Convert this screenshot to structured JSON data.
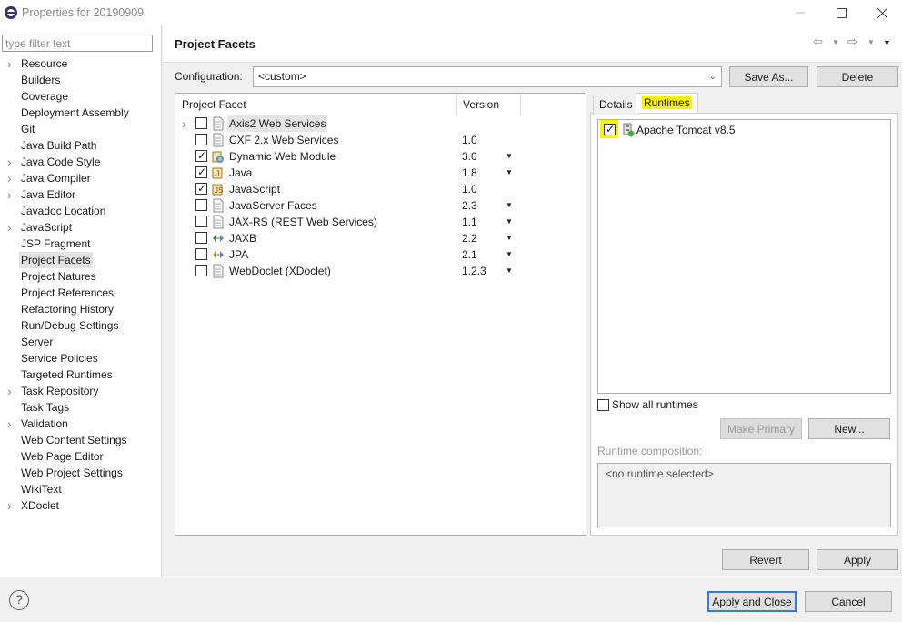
{
  "window": {
    "title": "Properties for 20190909",
    "controls": [
      "minimize-icon",
      "maximize-icon",
      "close-icon"
    ]
  },
  "filter": {
    "placeholder": "type filter text",
    "value": ""
  },
  "tree": {
    "items": [
      {
        "label": "Resource",
        "expandable": true
      },
      {
        "label": "Builders",
        "expandable": false
      },
      {
        "label": "Coverage",
        "expandable": false
      },
      {
        "label": "Deployment Assembly",
        "expandable": false
      },
      {
        "label": "Git",
        "expandable": false
      },
      {
        "label": "Java Build Path",
        "expandable": false
      },
      {
        "label": "Java Code Style",
        "expandable": true
      },
      {
        "label": "Java Compiler",
        "expandable": true
      },
      {
        "label": "Java Editor",
        "expandable": true
      },
      {
        "label": "Javadoc Location",
        "expandable": false
      },
      {
        "label": "JavaScript",
        "expandable": true
      },
      {
        "label": "JSP Fragment",
        "expandable": false
      },
      {
        "label": "Project Facets",
        "expandable": false,
        "selected": true
      },
      {
        "label": "Project Natures",
        "expandable": false
      },
      {
        "label": "Project References",
        "expandable": false
      },
      {
        "label": "Refactoring History",
        "expandable": false
      },
      {
        "label": "Run/Debug Settings",
        "expandable": false
      },
      {
        "label": "Server",
        "expandable": false
      },
      {
        "label": "Service Policies",
        "expandable": false
      },
      {
        "label": "Targeted Runtimes",
        "expandable": false
      },
      {
        "label": "Task Repository",
        "expandable": true
      },
      {
        "label": "Task Tags",
        "expandable": false
      },
      {
        "label": "Validation",
        "expandable": true
      },
      {
        "label": "Web Content Settings",
        "expandable": false
      },
      {
        "label": "Web Page Editor",
        "expandable": false
      },
      {
        "label": "Web Project Settings",
        "expandable": false
      },
      {
        "label": "WikiText",
        "expandable": false
      },
      {
        "label": "XDoclet",
        "expandable": true
      }
    ]
  },
  "header": {
    "title": "Project Facets"
  },
  "configuration": {
    "label": "Configuration:",
    "value": "<custom>",
    "save_as": "Save As...",
    "delete": "Delete"
  },
  "facets": {
    "col_facet": "Project Facet",
    "col_version": "Version",
    "rows": [
      {
        "name": "Axis2 Web Services",
        "version": "",
        "checked": false,
        "dropdown": false,
        "expandable": true,
        "icon": "document-icon"
      },
      {
        "name": "CXF 2.x Web Services",
        "version": "1.0",
        "checked": false,
        "dropdown": false,
        "icon": "document-icon"
      },
      {
        "name": "Dynamic Web Module",
        "version": "3.0",
        "checked": true,
        "dropdown": true,
        "icon": "web-module-icon"
      },
      {
        "name": "Java",
        "version": "1.8",
        "checked": true,
        "dropdown": true,
        "icon": "java-icon"
      },
      {
        "name": "JavaScript",
        "version": "1.0",
        "checked": true,
        "dropdown": false,
        "icon": "javascript-icon"
      },
      {
        "name": "JavaServer Faces",
        "version": "2.3",
        "checked": false,
        "dropdown": true,
        "icon": "document-icon"
      },
      {
        "name": "JAX-RS (REST Web Services)",
        "version": "1.1",
        "checked": false,
        "dropdown": true,
        "icon": "document-icon"
      },
      {
        "name": "JAXB",
        "version": "2.2",
        "checked": false,
        "dropdown": true,
        "icon": "jaxb-icon"
      },
      {
        "name": "JPA",
        "version": "2.1",
        "checked": false,
        "dropdown": true,
        "icon": "jpa-icon"
      },
      {
        "name": "WebDoclet (XDoclet)",
        "version": "1.2.3",
        "checked": false,
        "dropdown": true,
        "icon": "document-icon"
      }
    ]
  },
  "tabs": {
    "details": "Details",
    "runtimes": "Runtimes",
    "active": "runtimes"
  },
  "runtimes": {
    "items": [
      {
        "name": "Apache Tomcat v8.5",
        "checked": true
      }
    ],
    "show_all_label": "Show all runtimes",
    "make_primary": "Make Primary",
    "new_label": "New...",
    "composition_label": "Runtime composition:",
    "composition_value": "<no runtime selected>"
  },
  "actions": {
    "revert": "Revert",
    "apply": "Apply",
    "apply_close": "Apply and Close",
    "cancel": "Cancel"
  },
  "colors": {
    "highlight": "#fff200",
    "default_button_border": "#3b7ad4"
  }
}
